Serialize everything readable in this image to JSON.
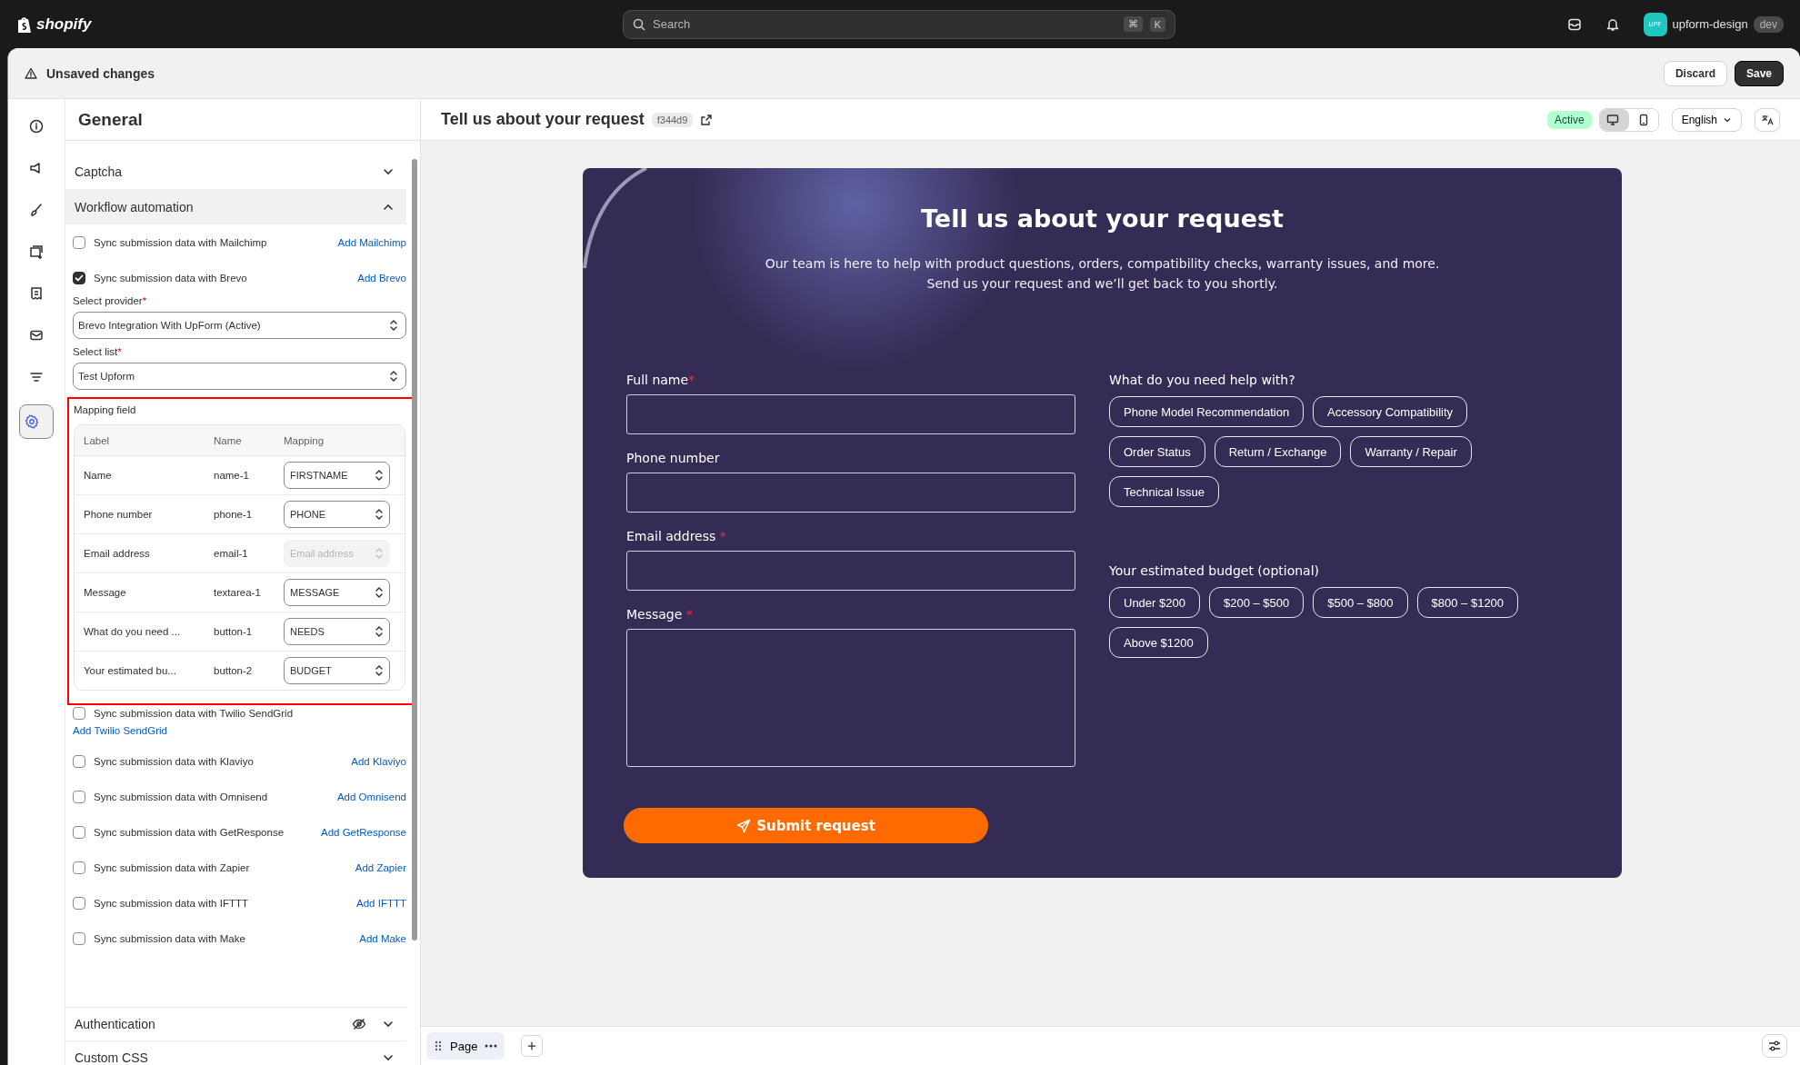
{
  "topbar": {
    "logo": "shopify",
    "search": {
      "placeholder": "Search",
      "keys": [
        "⌘",
        "K"
      ]
    },
    "store": {
      "avatar": "UPF",
      "name": "upform-design",
      "badge": "dev"
    }
  },
  "save_bar": {
    "message": "Unsaved changes",
    "buttons": [
      {
        "label": "Discard",
        "kind": "secondary"
      },
      {
        "label": "Save",
        "kind": "primary"
      }
    ]
  },
  "rail": [
    {
      "kind": "info",
      "selected": false
    },
    {
      "kind": "megaphone",
      "selected": false
    },
    {
      "kind": "brush",
      "selected": false
    },
    {
      "kind": "add-card",
      "selected": false
    },
    {
      "kind": "receipt",
      "selected": false
    },
    {
      "kind": "mail",
      "selected": false
    },
    {
      "kind": "filter",
      "selected": false
    },
    {
      "kind": "settings",
      "selected": true
    }
  ],
  "panel": {
    "title": "General",
    "captcha": {
      "label": "Captcha",
      "expanded": false
    },
    "workflow": {
      "label": "Workflow automation",
      "expanded": true,
      "integrations": [
        {
          "label": "Sync submission data with Mailchimp",
          "link": "Add Mailchimp",
          "checked": false,
          "kind": "inline"
        },
        {
          "label": "Sync submission data with Brevo",
          "link": "Add Brevo",
          "checked": true,
          "kind": "inline",
          "settings": {
            "provider": {
              "label": "Select provider",
              "required_mark": "*",
              "value": "Brevo Integration With UpForm (Active)"
            },
            "list": {
              "label": "Select list",
              "required_mark": "*",
              "value": "Test Upform"
            },
            "mapping": {
              "label": "Mapping field",
              "highlighted": true,
              "columns": [
                "Label",
                "Name",
                "Mapping"
              ],
              "rows": [
                {
                  "label": "Name",
                  "name": "name-1",
                  "value": "FIRSTNAME",
                  "disabled": false
                },
                {
                  "label": "Phone number",
                  "name": "phone-1",
                  "value": "PHONE",
                  "disabled": false
                },
                {
                  "label": "Email address",
                  "name": "email-1",
                  "placeholder": "Email address",
                  "disabled": true
                },
                {
                  "label": "Message",
                  "name": "textarea-1",
                  "value": "MESSAGE",
                  "disabled": false
                },
                {
                  "label": "What do you need ...",
                  "name": "button-1",
                  "value": "NEEDS",
                  "disabled": false
                },
                {
                  "label": "Your estimated bu...",
                  "name": "button-2",
                  "value": "BUDGET",
                  "disabled": false
                }
              ]
            }
          }
        },
        {
          "label": "Sync submission data with Twilio SendGrid",
          "link": "Add Twilio SendGrid",
          "checked": false,
          "kind": "stacked"
        },
        {
          "label": "Sync submission data with Klaviyo",
          "link": "Add Klaviyo",
          "checked": false,
          "kind": "inline"
        },
        {
          "label": "Sync submission data with Omnisend",
          "link": "Add Omnisend",
          "checked": false,
          "kind": "inline"
        },
        {
          "label": "Sync submission data with GetResponse",
          "link": "Add GetResponse",
          "checked": false,
          "kind": "inline"
        },
        {
          "label": "Sync submission data with Zapier",
          "link": "Add Zapier",
          "checked": false,
          "kind": "inline"
        },
        {
          "label": "Sync submission data with IFTTT",
          "link": "Add IFTTT",
          "checked": false,
          "kind": "inline"
        },
        {
          "label": "Sync submission data with Make",
          "link": "Add Make",
          "checked": false,
          "kind": "inline"
        }
      ]
    },
    "sections": [
      {
        "label": "Authentication",
        "expanded": false,
        "hidden": true
      },
      {
        "label": "Custom CSS",
        "expanded": false,
        "hidden": false
      }
    ]
  },
  "preview": {
    "title": "Tell us about your request",
    "form_id": "f344d9",
    "status": "Active",
    "devices": [
      {
        "kind": "desktop",
        "selected": true
      },
      {
        "kind": "mobile",
        "selected": false
      }
    ],
    "language": "English",
    "form": {
      "title": "Tell us about your request",
      "description": [
        "Our team is here to help with product questions, orders, compatibility checks, warranty issues, and more.",
        "Send us your request and we’ll get back to you shortly."
      ],
      "fields": [
        {
          "label": "Full name",
          "required_mark": "*",
          "kind": "input"
        },
        {
          "label": "Phone number",
          "kind": "input"
        },
        {
          "label": "Email address",
          "required_mark": "*",
          "kind": "input"
        },
        {
          "label": "Message",
          "required_mark": "*",
          "kind": "textarea"
        }
      ],
      "groups": [
        {
          "label": "What do you need help with?",
          "options": [
            "Phone Model Recommendation",
            "Accessory Compatibility",
            "Order Status",
            "Return / Exchange",
            "Warranty / Repair",
            "Technical Issue"
          ]
        },
        {
          "label": "Your estimated budget (optional)",
          "options": [
            "Under $200",
            "$200 – $500",
            "$500 – $800",
            "$800 – $1200",
            "Above $1200"
          ]
        }
      ],
      "submit": "Submit request"
    }
  },
  "bottom_bar": {
    "page_tab": "Page"
  }
}
